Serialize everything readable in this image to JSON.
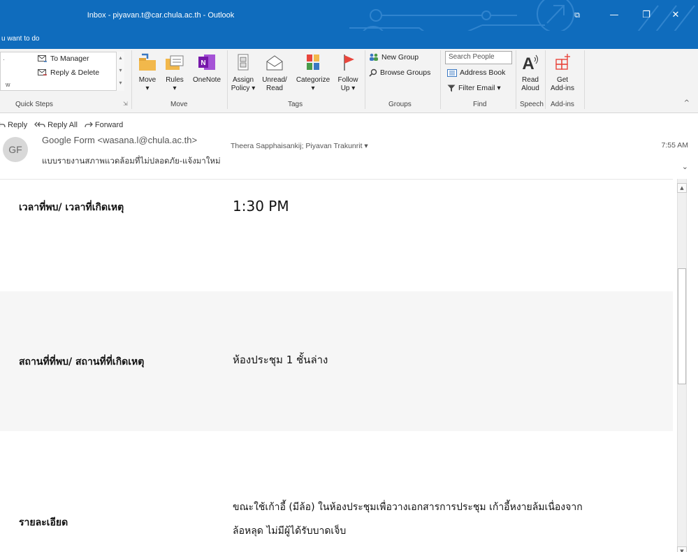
{
  "window": {
    "title": "Inbox - piyavan.t@car.chula.ac.th  -  Outlook",
    "tell_me": "u want to do",
    "controls": {
      "restore_ribbon": "⧉",
      "minimize": "—",
      "maximize": "❐",
      "close": "✕"
    }
  },
  "ribbon": {
    "quick_steps": {
      "items": [
        "To Manager",
        "Reply & Delete"
      ],
      "left_fragment_top": "·",
      "left_fragment_bottom": "w",
      "label": "Quick Steps"
    },
    "move": {
      "buttons": [
        {
          "label": "Move",
          "sub": "▾"
        },
        {
          "label": "Rules",
          "sub": "▾"
        },
        {
          "label": "OneNote",
          "sub": ""
        }
      ],
      "label": "Move"
    },
    "tags": {
      "buttons": [
        {
          "label": "Assign",
          "sub": "Policy ▾"
        },
        {
          "label": "Unread/",
          "sub": "Read"
        },
        {
          "label": "Categorize",
          "sub": "▾"
        },
        {
          "label": "Follow",
          "sub": "Up ▾"
        }
      ],
      "label": "Tags"
    },
    "groups": {
      "items": [
        "New Group",
        "Browse Groups"
      ],
      "label": "Groups"
    },
    "find": {
      "search_placeholder": "Search People",
      "address_book": "Address Book",
      "filter_email": "Filter Email ▾",
      "label": "Find"
    },
    "speech": {
      "button": "Read",
      "button_sub": "Aloud",
      "label": "Speech"
    },
    "addins": {
      "button": "Get",
      "button_sub": "Add-ins",
      "label": "Add-ins"
    },
    "collapse": "^"
  },
  "message": {
    "actions": [
      "Reply",
      "Reply All",
      "Forward"
    ],
    "avatar": "GF",
    "sender": "Google Form <wasana.l@chula.ac.th>",
    "recipients": "Theera  Sapphaisankij; Piyavan  Trakunrit  ▾",
    "time": "7:55 AM",
    "subject": "แบบรายงานสภาพแวดล้อมที่ไม่ปลอดภัย-แจ้งมาใหม่",
    "expand": "⌄"
  },
  "form": {
    "rows": [
      {
        "label": "เวลาที่พบ/ เวลาที่เกิดเหตุ",
        "value": "1:30 PM"
      },
      {
        "label": "สถานที่ที่พบ/ สถานที่ที่เกิดเหตุ",
        "value": "ห้องประชุม 1 ชั้นล่าง"
      },
      {
        "label": "รายละเอียด",
        "value_line1": "ขณะใช้เก้าอี้ (มีล้อ) ในห้องประชุมเพื่อวางเอกสารการประชุม เก้าอี้หงายล้มเนื่องจาก",
        "value_line2": "ล้อหลุด ไม่มีผู้ได้รับบาดเจ็บ"
      }
    ]
  },
  "colors": {
    "title_bar": "#0f6cbd",
    "ribbon_bg": "#f3f3f3",
    "row_alt": "#f6f6f6",
    "flag_red": "#e8453c",
    "onenote_purple": "#7719aa",
    "folder_yellow": "#f2b84b"
  }
}
